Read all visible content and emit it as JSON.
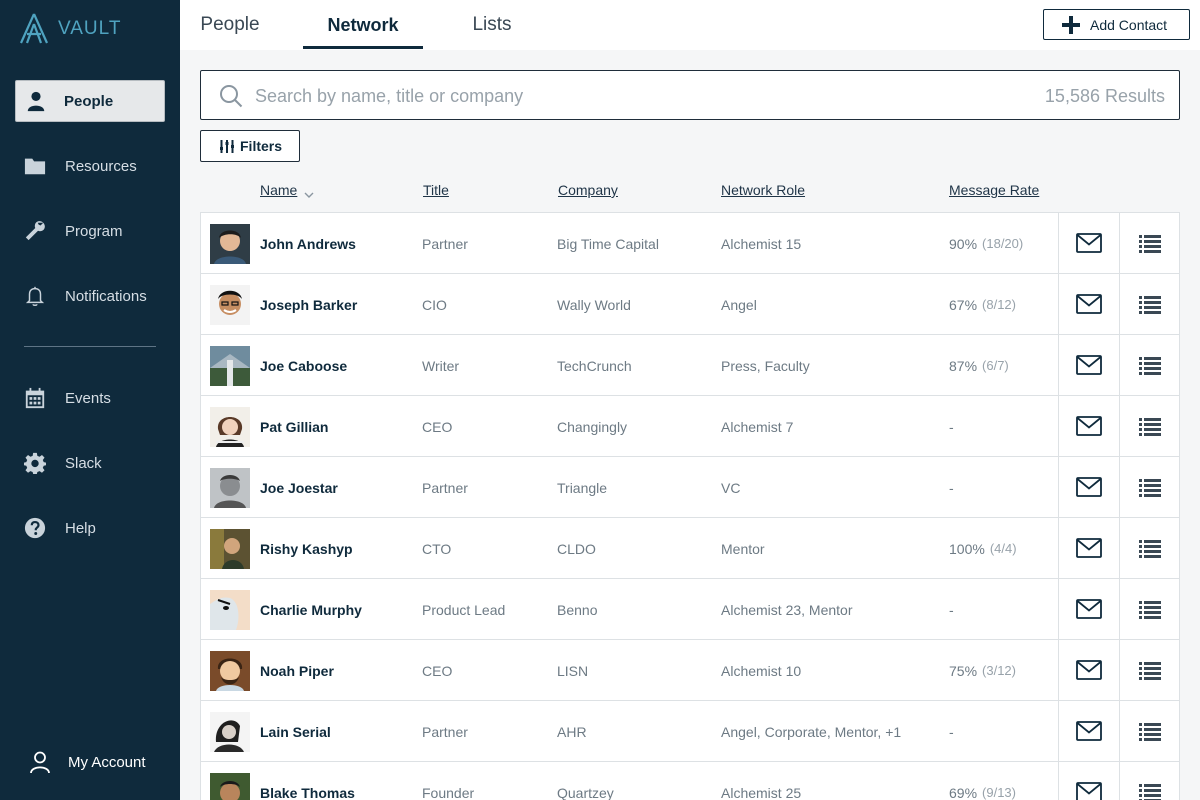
{
  "app": {
    "brand": "VAULT",
    "accent_color": "#4fa3c0",
    "sidebar_color": "#0f2a3c"
  },
  "sidebar": {
    "items": [
      {
        "label": "People",
        "icon": "person-icon",
        "active": true
      },
      {
        "label": "Resources",
        "icon": "folder-icon"
      },
      {
        "label": "Program",
        "icon": "wrench-icon"
      },
      {
        "label": "Notifications",
        "icon": "bell-icon"
      },
      {
        "label": "Events",
        "icon": "calendar-icon"
      },
      {
        "label": "Slack",
        "icon": "gear-icon"
      },
      {
        "label": "Help",
        "icon": "help-icon"
      }
    ],
    "account": {
      "label": "My Account",
      "icon": "user-outline-icon"
    }
  },
  "tabs": [
    {
      "label": "People"
    },
    {
      "label": "Network",
      "active": true
    },
    {
      "label": "Lists"
    }
  ],
  "toolbar": {
    "add_label": "Add Contact",
    "filters_label": "Filters"
  },
  "search": {
    "placeholder": "Search by name, title or company",
    "results": "15,586 Results"
  },
  "columns": {
    "name": "Name",
    "title": "Title",
    "company": "Company",
    "role": "Network Role",
    "rate": "Message Rate"
  },
  "rows": [
    {
      "name": "John Andrews",
      "title": "Partner",
      "company": "Big Time Capital",
      "role": "Alchemist 15",
      "rate": "90%",
      "count": "(18/20)"
    },
    {
      "name": "Joseph Barker",
      "title": "CIO",
      "company": "Wally World",
      "role": "Angel",
      "rate": "67%",
      "count": "(8/12)"
    },
    {
      "name": "Joe Caboose",
      "title": "Writer",
      "company": "TechCrunch",
      "role": "Press, Faculty",
      "rate": "87%",
      "count": "(6/7)"
    },
    {
      "name": "Pat Gillian",
      "title": "CEO",
      "company": "Changingly",
      "role": "Alchemist 7",
      "rate": "-",
      "count": ""
    },
    {
      "name": "Joe Joestar",
      "title": "Partner",
      "company": "Triangle",
      "role": "VC",
      "rate": "-",
      "count": ""
    },
    {
      "name": "Rishy Kashyp",
      "title": "CTO",
      "company": "CLDO",
      "role": "Mentor",
      "rate": "100%",
      "count": "(4/4)"
    },
    {
      "name": "Charlie Murphy",
      "title": "Product Lead",
      "company": "Benno",
      "role": "Alchemist 23, Mentor",
      "rate": "-",
      "count": ""
    },
    {
      "name": "Noah Piper",
      "title": "CEO",
      "company": "LISN",
      "role": "Alchemist 10",
      "rate": "75%",
      "count": "(3/12)"
    },
    {
      "name": "Lain Serial",
      "title": "Partner",
      "company": "AHR",
      "role": "Angel, Corporate, Mentor, +1",
      "rate": "-",
      "count": ""
    },
    {
      "name": "Blake Thomas",
      "title": "Founder",
      "company": "Quartzey",
      "role": "Alchemist 25",
      "rate": "69%",
      "count": "(9/13)"
    }
  ]
}
